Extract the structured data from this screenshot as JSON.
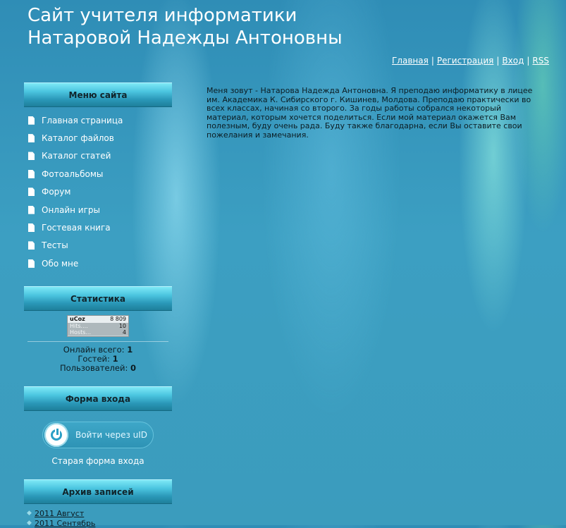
{
  "header": {
    "title_line1": "Сайт учителя информатики",
    "title_line2": "Натаровой Надежды Антоновны"
  },
  "topnav": {
    "home": "Главная",
    "register": "Регистрация",
    "login": "Вход",
    "rss": "RSS",
    "separator": "|"
  },
  "menu": {
    "title": "Меню сайта",
    "items": [
      {
        "label": "Главная страница",
        "icon": "page-icon"
      },
      {
        "label": "Каталог файлов",
        "icon": "page-icon"
      },
      {
        "label": "Каталог статей",
        "icon": "page-icon"
      },
      {
        "label": "Фотоальбомы",
        "icon": "page-icon"
      },
      {
        "label": "Форум",
        "icon": "page-icon"
      },
      {
        "label": "Онлайн игры",
        "icon": "page-icon"
      },
      {
        "label": "Гостевая книга",
        "icon": "page-icon"
      },
      {
        "label": "Тесты",
        "icon": "page-icon"
      },
      {
        "label": "Обо мне",
        "icon": "page-icon"
      }
    ]
  },
  "main": {
    "text": "Меня зовут - Натарова Надежда Антоновна. Я преподаю информатику в лицее им. Академика К. Сибирского г. Кишинев, Молдова. Преподаю практически во всех классах, начиная со второго. За годы работы собрался некоторый материал, которым хочется поделиться. Если мой материал окажется Вам полезным, буду очень рада. Буду также благодарна, если Вы оставите свои пожелания и замечания."
  },
  "statistics": {
    "title": "Статистика",
    "counter": {
      "brand": "uCoz",
      "total": "8 809",
      "hits_label": "Hits....",
      "hits": "10",
      "hosts_label": "Hosts...",
      "hosts": "4"
    },
    "online_label": "Онлайн всего:",
    "online_value": "1",
    "guests_label": "Гостей:",
    "guests_value": "1",
    "users_label": "Пользователей:",
    "users_value": "0"
  },
  "login_form": {
    "title": "Форма входа",
    "uid_button": "Войти через uID",
    "old_form": "Старая форма входа"
  },
  "archive": {
    "title": "Архив записей",
    "items": [
      "2011 Август",
      "2011 Сентябрь"
    ]
  },
  "colors": {
    "background": "#3b9cbd",
    "block_header": "#4cc6e0",
    "dark_text": "#0c1c22"
  }
}
